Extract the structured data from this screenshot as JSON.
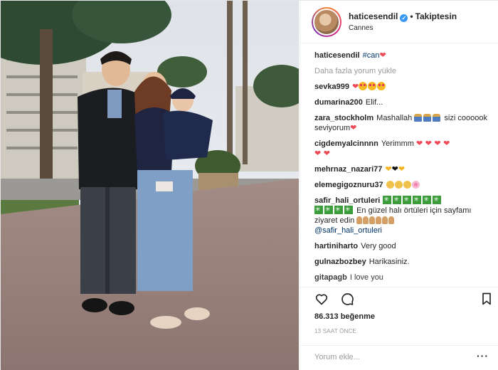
{
  "post": {
    "username": "haticesendil",
    "follow_status": "Takiptesin",
    "location": "Cannes",
    "caption_user": "haticesendil",
    "caption_tag": "#can",
    "load_more": "Daha fazla yorum yükle",
    "likes": "86.313 beğenme",
    "time": "13 SAAT ÖNCE",
    "comment_placeholder": "Yorum ekle...",
    "more_label": "···"
  },
  "comments": [
    {
      "user": "sevka999",
      "text": ""
    },
    {
      "user": "dumarina200",
      "text": "Elif..."
    },
    {
      "user": "zara_stockholm",
      "text": "Mashallah",
      "text2": "sizi coooook seviyorum"
    },
    {
      "user": "cigdemyalcinnnn",
      "text": "Yerimmm"
    },
    {
      "user": "mehrnaz_nazari77",
      "text": ""
    },
    {
      "user": "elemegigoznuru37",
      "text": ""
    },
    {
      "user": "safir_hali_ortuleri",
      "text": "En güzel halı örtüleri için sayfamı ziyaret edin",
      "mention": "@safir_hali_ortuleri"
    },
    {
      "user": "hartiniharto",
      "text": "Very good"
    },
    {
      "user": "gulnazbozbey",
      "text": "Harikasiniz."
    },
    {
      "user": "gitapagb",
      "text": "I love you"
    }
  ],
  "icons": [
    "heart-outline-icon",
    "comment-icon",
    "bookmark-icon",
    "verified-icon"
  ],
  "colors": {
    "verified": "#3897f0",
    "like_heart": "#ed4956",
    "mention": "#003569",
    "muted": "#999999"
  }
}
